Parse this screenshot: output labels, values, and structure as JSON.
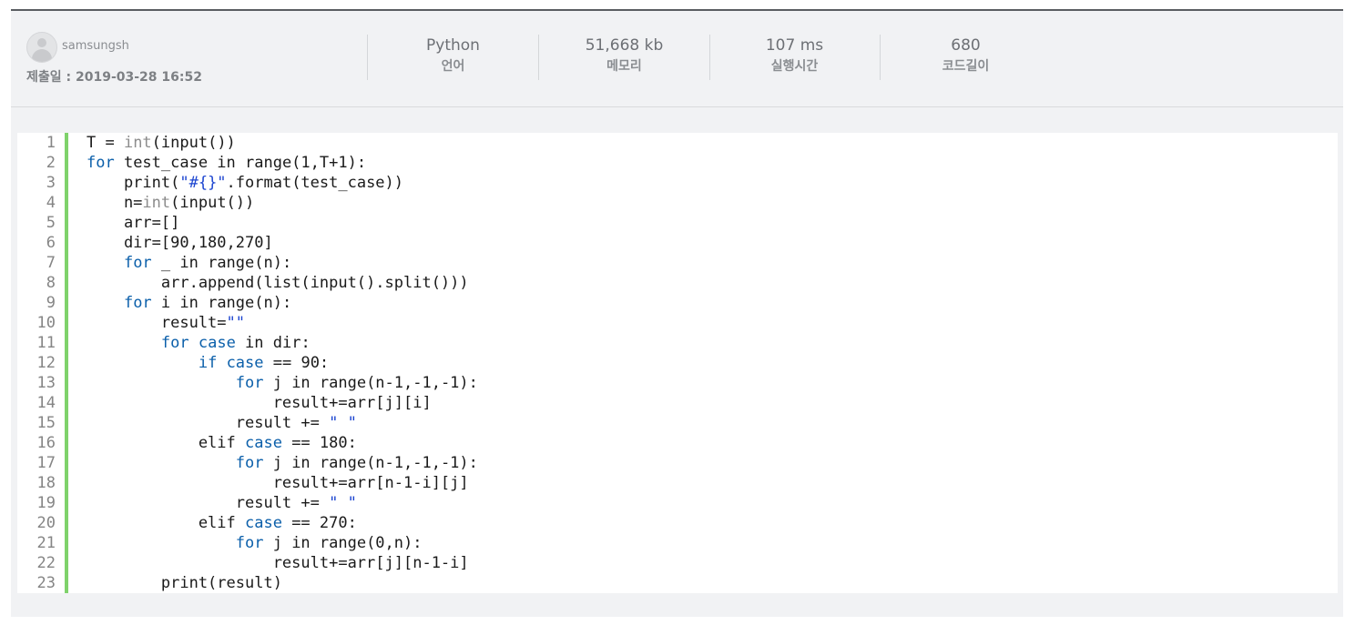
{
  "submission": {
    "username": "samsungsh",
    "submitted_label": "제출일 : 2019-03-28 16:52"
  },
  "stats": [
    {
      "value": "Python",
      "label": "언어"
    },
    {
      "value": "51,668 kb",
      "label": "메모리"
    },
    {
      "value": "107 ms",
      "label": "실행시간"
    },
    {
      "value": "680",
      "label": "코드길이"
    }
  ],
  "code": {
    "line_numbers": [
      "1",
      "2",
      "3",
      "4",
      "5",
      "6",
      "7",
      "8",
      "9",
      "10",
      "11",
      "12",
      "13",
      "14",
      "15",
      "16",
      "17",
      "18",
      "19",
      "20",
      "21",
      "22",
      "23"
    ],
    "lines": [
      [
        [
          "T = ",
          ""
        ],
        [
          "int",
          "bi"
        ],
        [
          "(input())",
          ""
        ]
      ],
      [
        [
          "for",
          "kw"
        ],
        [
          " test_case in range(1,T+1):",
          ""
        ]
      ],
      [
        [
          "    print(",
          ""
        ],
        [
          "\"#{}\"",
          "str"
        ],
        [
          ".format(test_case))",
          ""
        ]
      ],
      [
        [
          "    n=",
          ""
        ],
        [
          "int",
          "bi"
        ],
        [
          "(input())",
          ""
        ]
      ],
      [
        [
          "    arr=[]",
          ""
        ]
      ],
      [
        [
          "    dir=[90,180,270]",
          ""
        ]
      ],
      [
        [
          "    ",
          ""
        ],
        [
          "for",
          "kw"
        ],
        [
          " _ in range(n):",
          ""
        ]
      ],
      [
        [
          "        arr.append(list(input().split()))",
          ""
        ]
      ],
      [
        [
          "    ",
          ""
        ],
        [
          "for",
          "kw"
        ],
        [
          " i in range(n):",
          ""
        ]
      ],
      [
        [
          "        result=",
          ""
        ],
        [
          "\"\"",
          "str"
        ]
      ],
      [
        [
          "        ",
          ""
        ],
        [
          "for",
          "kw"
        ],
        [
          " ",
          ""
        ],
        [
          "case",
          "kw"
        ],
        [
          " in dir:",
          ""
        ]
      ],
      [
        [
          "            ",
          ""
        ],
        [
          "if",
          "kw"
        ],
        [
          " ",
          ""
        ],
        [
          "case",
          "kw"
        ],
        [
          " == 90:",
          ""
        ]
      ],
      [
        [
          "                ",
          ""
        ],
        [
          "for",
          "kw"
        ],
        [
          " j in range(n-1,-1,-1):",
          ""
        ]
      ],
      [
        [
          "                    result+=arr[j][i]",
          ""
        ]
      ],
      [
        [
          "                result += ",
          ""
        ],
        [
          "\" \"",
          "str"
        ]
      ],
      [
        [
          "            elif ",
          ""
        ],
        [
          "case",
          "kw"
        ],
        [
          " == 180:",
          ""
        ]
      ],
      [
        [
          "                ",
          ""
        ],
        [
          "for",
          "kw"
        ],
        [
          " j in range(n-1,-1,-1):",
          ""
        ]
      ],
      [
        [
          "                    result+=arr[n-1-i][j]",
          ""
        ]
      ],
      [
        [
          "                result += ",
          ""
        ],
        [
          "\" \"",
          "str"
        ]
      ],
      [
        [
          "            elif ",
          ""
        ],
        [
          "case",
          "kw"
        ],
        [
          " == 270:",
          ""
        ]
      ],
      [
        [
          "                ",
          ""
        ],
        [
          "for",
          "kw"
        ],
        [
          " j in range(0,n):",
          ""
        ]
      ],
      [
        [
          "                    result+=arr[j][n-1-i]",
          ""
        ]
      ],
      [
        [
          "        print(result)",
          ""
        ]
      ]
    ]
  }
}
